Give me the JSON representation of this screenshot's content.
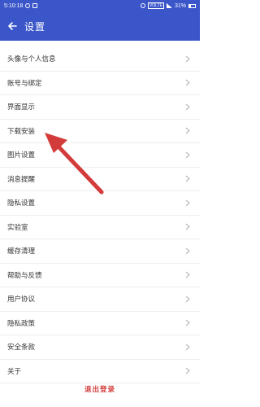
{
  "status_bar": {
    "time": "5:10:18",
    "network": "VOLTE",
    "battery": "31%"
  },
  "app_bar": {
    "title": "设置",
    "back_icon": "arrow-left-icon"
  },
  "settings_items": [
    {
      "label": "头像与个人信息"
    },
    {
      "label": "账号与绑定"
    },
    {
      "label": "界面显示"
    },
    {
      "label": "下载安装"
    },
    {
      "label": "图片设置"
    },
    {
      "label": "消息提醒"
    },
    {
      "label": "隐私设置"
    },
    {
      "label": "实验室"
    },
    {
      "label": "缓存清理"
    },
    {
      "label": "帮助与反馈"
    },
    {
      "label": "用户协议"
    },
    {
      "label": "隐私政策"
    },
    {
      "label": "安全条款"
    },
    {
      "label": "关于"
    }
  ],
  "logout": {
    "label": "退出登录"
  },
  "colors": {
    "primary": "#3b56c9",
    "logout_text": "#d23b3b",
    "arrow_annotation": "#d33a3a"
  }
}
